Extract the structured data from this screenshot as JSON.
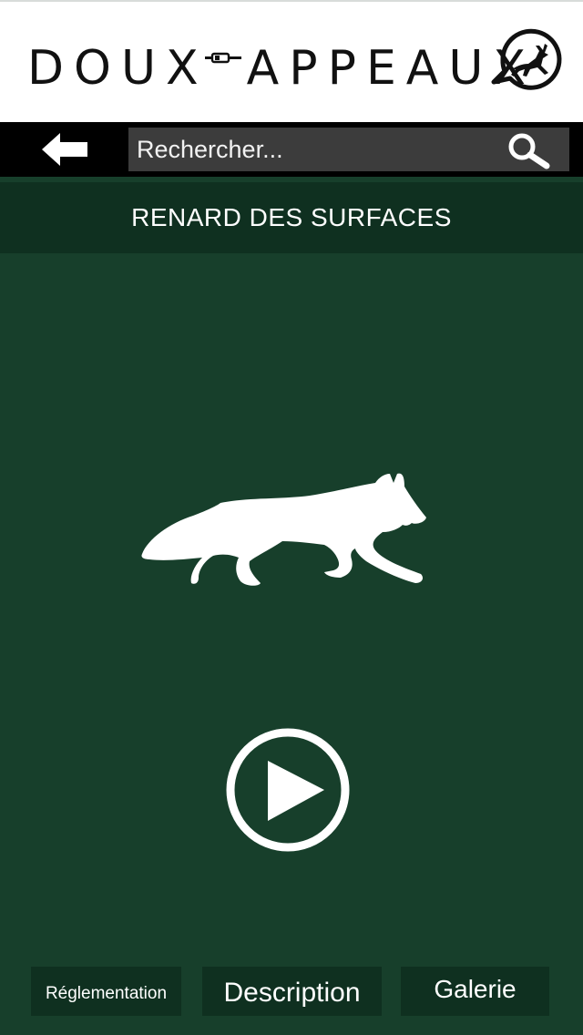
{
  "header": {
    "logo_left": "DOUX",
    "logo_right": "APPEAUX",
    "logo_icon": "deer-call-emblem-icon"
  },
  "search": {
    "placeholder": "Rechercher...",
    "back_icon": "back-arrow-icon",
    "search_icon": "magnifier-icon"
  },
  "page": {
    "title": "RENARD DES SURFACES",
    "animal_icon": "fox-silhouette-icon",
    "play_icon": "play-circle-icon"
  },
  "tabs": {
    "reglementation": "Réglementation",
    "description": "Description",
    "galerie": "Galerie"
  },
  "colors": {
    "background": "#173f2b",
    "band": "#0f3020",
    "search_bg": "#3c3c3c",
    "header_bg": "#ffffff"
  }
}
